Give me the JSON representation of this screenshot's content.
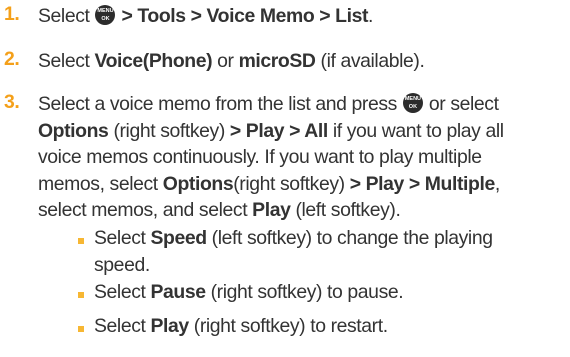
{
  "menu_key": {
    "top": "MENU",
    "bottom": "OK"
  },
  "steps": [
    {
      "number": "1.",
      "parts": {
        "a": "Select ",
        "b": "> Tools > Voice Memo > List",
        "c": "."
      }
    },
    {
      "number": "2.",
      "parts": {
        "a": "Select ",
        "b": "Voice(Phone)",
        "c": " or ",
        "d": "microSD",
        "e": " (if available)."
      }
    },
    {
      "number": "3.",
      "lines": [
        {
          "a": "Select a voice memo from the list and press ",
          "b": " or select"
        },
        {
          "a": "Options",
          "b": " (right softkey) ",
          "c": "> Play > All",
          "d": " if you want to play all"
        },
        {
          "a": "voice memos continuously. If you want to play multiple"
        },
        {
          "a": "memos, select ",
          "b": "Options",
          "c": "(right softkey) ",
          "d": "> Play > Multiple",
          "e": ","
        },
        {
          "a": "select memos, and select ",
          "b": "Play",
          "c": " (left softkey)."
        }
      ]
    }
  ],
  "sub_items": [
    {
      "lines": [
        {
          "a": "Select ",
          "b": "Speed",
          "c": " (left softkey) to change the playing"
        },
        {
          "a": "speed."
        }
      ]
    },
    {
      "lines": [
        {
          "a": "Select ",
          "b": "Pause",
          "c": " (right softkey) to pause."
        }
      ]
    },
    {
      "lines": [
        {
          "a": "Select ",
          "b": "Play",
          "c": " (right softkey) to restart."
        }
      ]
    }
  ],
  "colors": {
    "number": "#f4a01a",
    "bullet": "#f7b733",
    "text": "#333333"
  },
  "icons": {
    "menu_key": "menu-ok-key-icon"
  }
}
